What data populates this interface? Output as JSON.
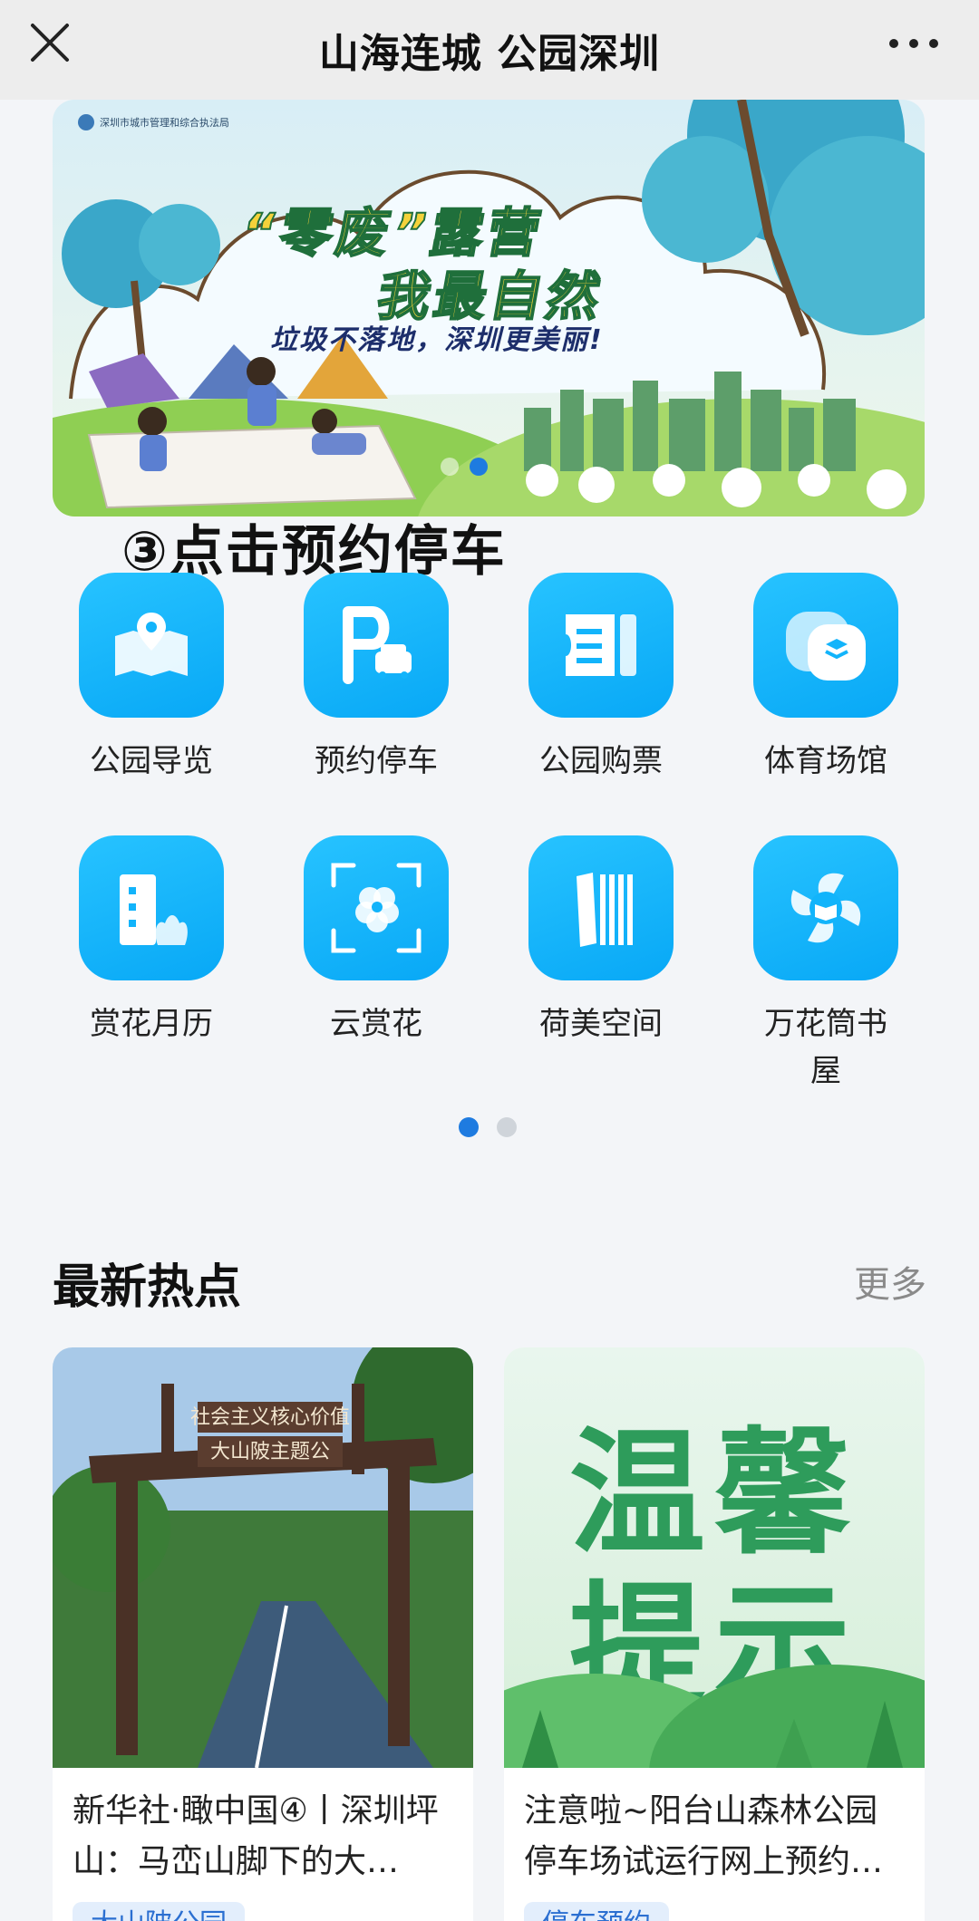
{
  "topbar": {
    "title": "山海连城 公园深圳",
    "close_icon": "close-icon",
    "more_icon": "more-dots-icon"
  },
  "banner": {
    "org": "深圳市城市管理和综合执法局",
    "slogan_line1": "“零废”露营",
    "slogan_line2": "我最自然",
    "slogan_line3": "垃圾不落地，深圳更美丽!",
    "slide_count": 2,
    "active_slide": 2
  },
  "annotation": "③点击预约停车",
  "services": [
    {
      "label": "公园导览",
      "icon": "map-pin-icon"
    },
    {
      "label": "预约停车",
      "icon": "parking-car-icon"
    },
    {
      "label": "公园购票",
      "icon": "ticket-icon"
    },
    {
      "label": "体育场馆",
      "icon": "stadium-icon"
    },
    {
      "label": "赏花月历",
      "icon": "building-flower-icon"
    },
    {
      "label": "云赏花",
      "icon": "flower-scan-icon"
    },
    {
      "label": "荷美空间",
      "icon": "book-stack-icon"
    },
    {
      "label": "万花筒书屋",
      "icon": "kaleidoscope-book-icon"
    }
  ],
  "pager": {
    "pages": 2,
    "active": 1
  },
  "hot": {
    "title": "最新热点",
    "more": "更多",
    "cards": [
      {
        "title": "新华社·瞰中国④丨深圳坪山：马峦山脚下的大…",
        "tag": "大山陂公园",
        "sign_top": "社会主义核心价值",
        "sign_bottom": "大山陂主题公"
      },
      {
        "title": "注意啦~阳台山森林公园停车场试运行网上预约…",
        "tag": "停车预约",
        "poster_line1": "温馨",
        "poster_line2": "提示"
      }
    ]
  },
  "colors": {
    "accent": "#1e7be0",
    "icon_bg": "#12b4fb",
    "tag_bg": "#e3eefc",
    "tag_text": "#2b6fd1"
  }
}
